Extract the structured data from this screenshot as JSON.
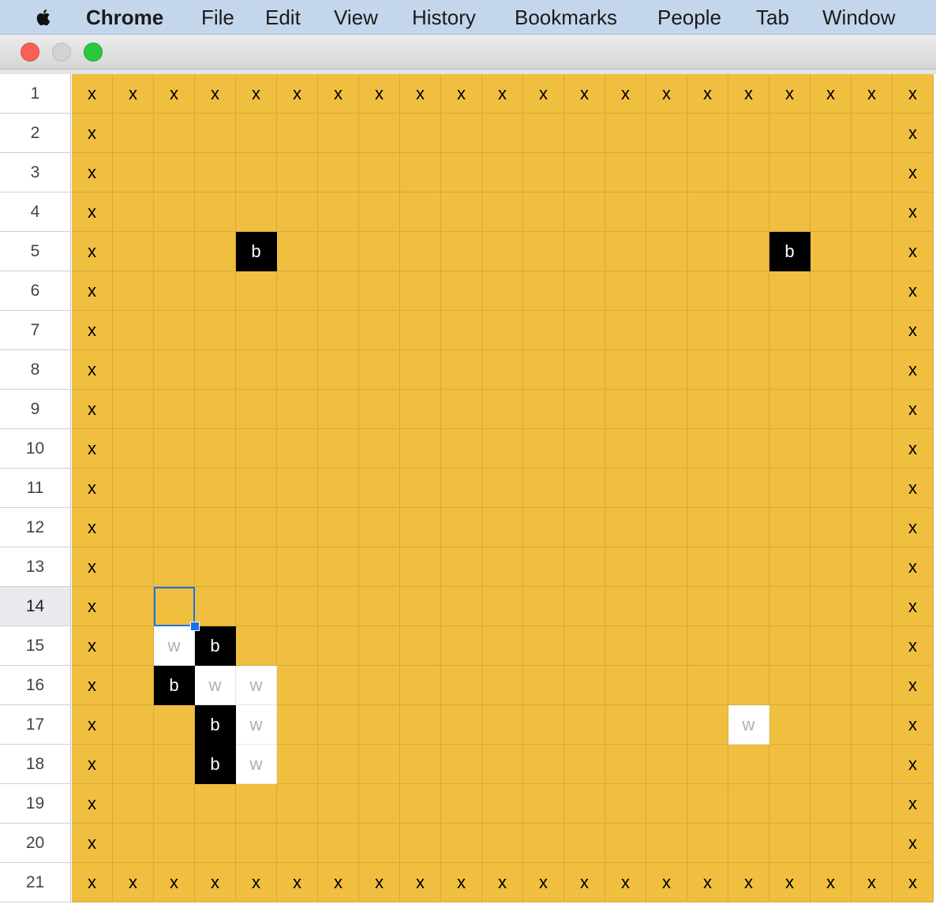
{
  "menubar": {
    "apple_icon": "apple-logo-icon",
    "app_name": "Chrome",
    "items": [
      "File",
      "Edit",
      "View",
      "History",
      "Bookmarks",
      "People",
      "Tab",
      "Window"
    ]
  },
  "window": {
    "controls": [
      "close",
      "minimize",
      "zoom"
    ]
  },
  "sheet": {
    "row_labels": [
      "1",
      "2",
      "3",
      "4",
      "5",
      "6",
      "7",
      "8",
      "9",
      "10",
      "11",
      "12",
      "13",
      "14",
      "15",
      "16",
      "17",
      "18",
      "19",
      "20",
      "21"
    ],
    "active_row": "14",
    "cells": [
      [
        "x",
        "x",
        "x",
        "x",
        "x",
        "x",
        "x",
        "x",
        "x",
        "x",
        "x",
        "x",
        "x",
        "x",
        "x",
        "x",
        "x",
        "x",
        "x",
        "x",
        "x"
      ],
      [
        "x",
        "",
        "",
        "",
        "",
        "",
        "",
        "",
        "",
        "",
        "",
        "",
        "",
        "",
        "",
        "",
        "",
        "",
        "",
        "",
        "x"
      ],
      [
        "x",
        "",
        "",
        "",
        "",
        "",
        "",
        "",
        "",
        "",
        "",
        "",
        "",
        "",
        "",
        "",
        "",
        "",
        "",
        "",
        "x"
      ],
      [
        "x",
        "",
        "",
        "",
        "",
        "",
        "",
        "",
        "",
        "",
        "",
        "",
        "",
        "",
        "",
        "",
        "",
        "",
        "",
        "",
        "x"
      ],
      [
        "x",
        "",
        "",
        "",
        "b",
        "",
        "",
        "",
        "",
        "",
        "",
        "",
        "",
        "",
        "",
        "",
        "",
        "b",
        "",
        "",
        "x"
      ],
      [
        "x",
        "",
        "",
        "",
        "",
        "",
        "",
        "",
        "",
        "",
        "",
        "",
        "",
        "",
        "",
        "",
        "",
        "",
        "",
        "",
        "x"
      ],
      [
        "x",
        "",
        "",
        "",
        "",
        "",
        "",
        "",
        "",
        "",
        "",
        "",
        "",
        "",
        "",
        "",
        "",
        "",
        "",
        "",
        "x"
      ],
      [
        "x",
        "",
        "",
        "",
        "",
        "",
        "",
        "",
        "",
        "",
        "",
        "",
        "",
        "",
        "",
        "",
        "",
        "",
        "",
        "",
        "x"
      ],
      [
        "x",
        "",
        "",
        "",
        "",
        "",
        "",
        "",
        "",
        "",
        "",
        "",
        "",
        "",
        "",
        "",
        "",
        "",
        "",
        "",
        "x"
      ],
      [
        "x",
        "",
        "",
        "",
        "",
        "",
        "",
        "",
        "",
        "",
        "",
        "",
        "",
        "",
        "",
        "",
        "",
        "",
        "",
        "",
        "x"
      ],
      [
        "x",
        "",
        "",
        "",
        "",
        "",
        "",
        "",
        "",
        "",
        "",
        "",
        "",
        "",
        "",
        "",
        "",
        "",
        "",
        "",
        "x"
      ],
      [
        "x",
        "",
        "",
        "",
        "",
        "",
        "",
        "",
        "",
        "",
        "",
        "",
        "",
        "",
        "",
        "",
        "",
        "",
        "",
        "",
        "x"
      ],
      [
        "x",
        "",
        "",
        "",
        "",
        "",
        "",
        "",
        "",
        "",
        "",
        "",
        "",
        "",
        "",
        "",
        "",
        "",
        "",
        "",
        "x"
      ],
      [
        "x",
        "",
        "",
        "",
        "",
        "",
        "",
        "",
        "",
        "",
        "",
        "",
        "",
        "",
        "",
        "",
        "",
        "",
        "",
        "",
        "x"
      ],
      [
        "x",
        "",
        "w",
        "b",
        "",
        "",
        "",
        "",
        "",
        "",
        "",
        "",
        "",
        "",
        "",
        "",
        "",
        "",
        "",
        "",
        "x"
      ],
      [
        "x",
        "",
        "b",
        "w",
        "w",
        "",
        "",
        "",
        "",
        "",
        "",
        "",
        "",
        "",
        "",
        "",
        "",
        "",
        "",
        "",
        "x"
      ],
      [
        "x",
        "",
        "",
        "b",
        "w",
        "",
        "",
        "",
        "",
        "",
        "",
        "",
        "",
        "",
        "",
        "",
        "w",
        "",
        "",
        "",
        "x"
      ],
      [
        "x",
        "",
        "",
        "b",
        "w",
        "",
        "",
        "",
        "",
        "",
        "",
        "",
        "",
        "",
        "",
        "",
        "",
        "",
        "",
        "",
        "x"
      ],
      [
        "x",
        "",
        "",
        "",
        "",
        "",
        "",
        "",
        "",
        "",
        "",
        "",
        "",
        "",
        "",
        "",
        "",
        "",
        "",
        "",
        "x"
      ],
      [
        "x",
        "",
        "",
        "",
        "",
        "",
        "",
        "",
        "",
        "",
        "",
        "",
        "",
        "",
        "",
        "",
        "",
        "",
        "",
        "",
        "x"
      ],
      [
        "x",
        "x",
        "x",
        "x",
        "x",
        "x",
        "x",
        "x",
        "x",
        "x",
        "x",
        "x",
        "x",
        "x",
        "x",
        "x",
        "x",
        "x",
        "x",
        "x",
        "x"
      ]
    ],
    "selected_cell": {
      "row": 14,
      "col": 3
    },
    "colors": {
      "board": "#f0bf3f",
      "black_stone": "#000000",
      "white_stone": "#ffffff",
      "selection": "#1a73e8"
    }
  }
}
